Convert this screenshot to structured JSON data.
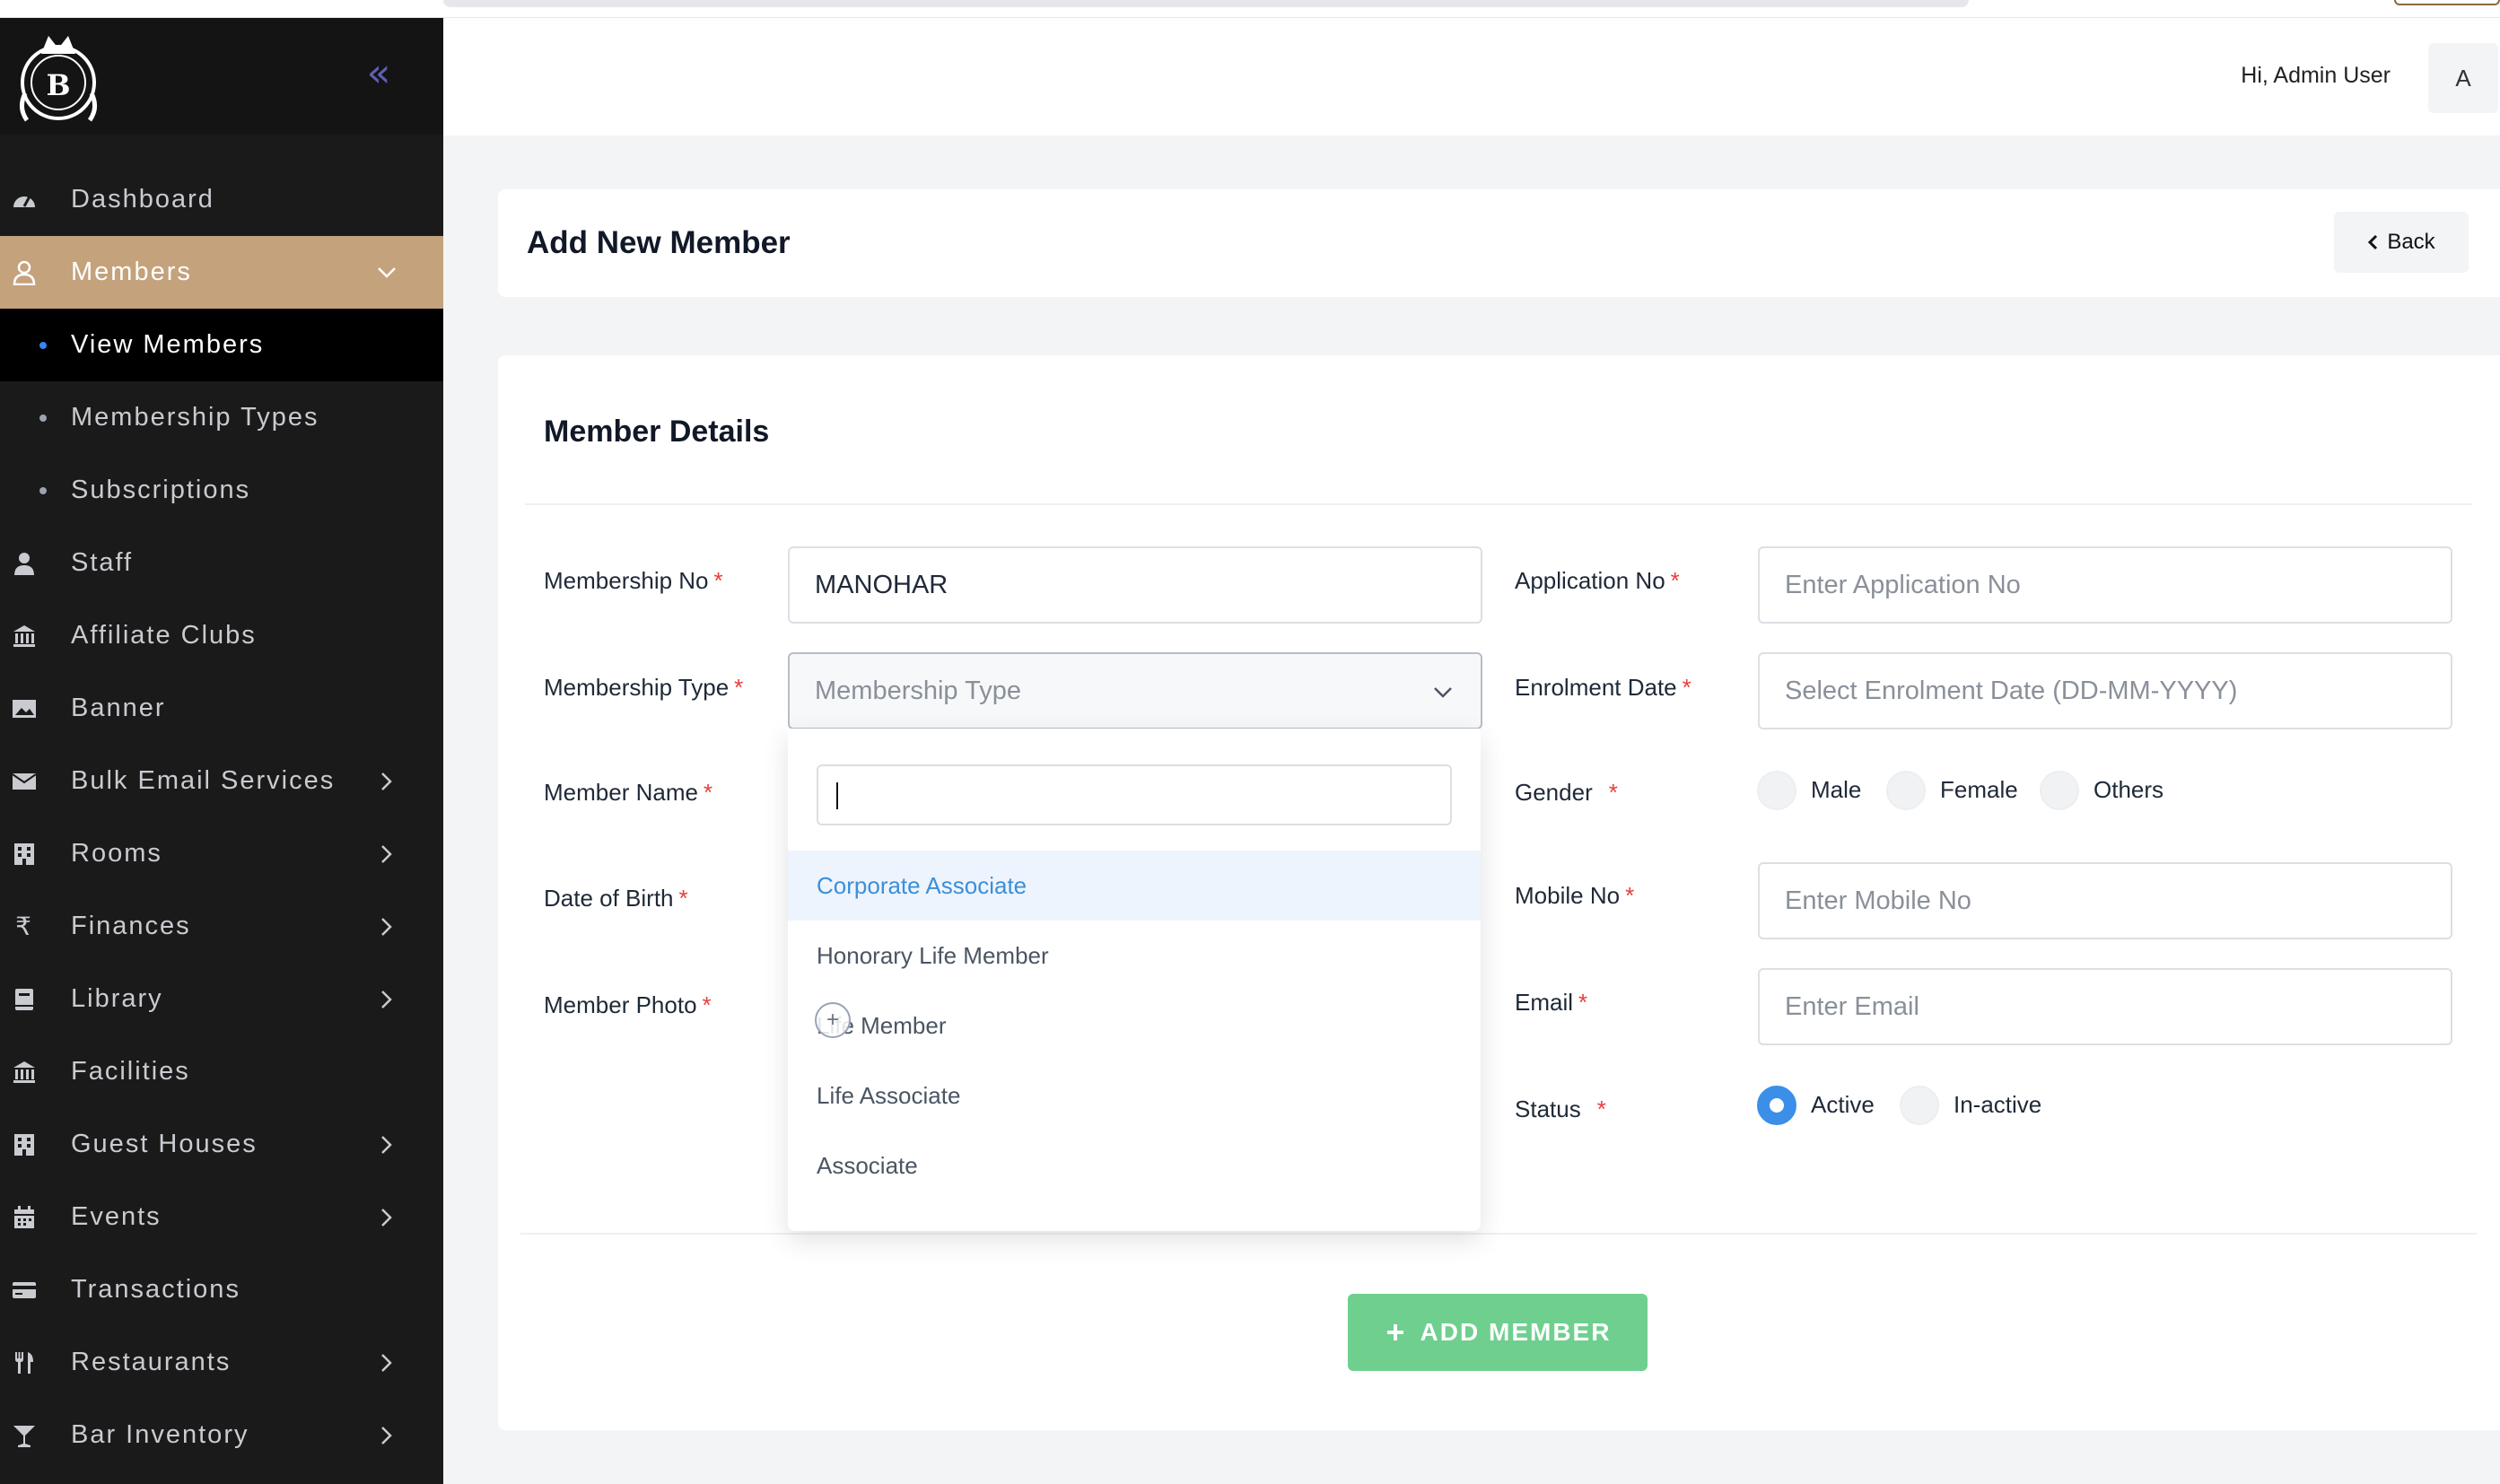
{
  "header": {
    "greeting": "Hi, Admin User",
    "avatar_initial": "A"
  },
  "sidebar": {
    "items": [
      {
        "label": "Dashboard",
        "icon": "dashboard-icon"
      },
      {
        "label": "Members",
        "icon": "user-icon",
        "expanded": true
      },
      {
        "label": "View Members",
        "sub": true,
        "active": true
      },
      {
        "label": "Membership Types",
        "sub": true
      },
      {
        "label": "Subscriptions",
        "sub": true
      },
      {
        "label": "Staff",
        "icon": "staff-icon"
      },
      {
        "label": "Affiliate Clubs",
        "icon": "bank-icon"
      },
      {
        "label": "Banner",
        "icon": "image-icon"
      },
      {
        "label": "Bulk Email Services",
        "icon": "envelope-icon",
        "has_children": true
      },
      {
        "label": "Rooms",
        "icon": "building-icon",
        "has_children": true
      },
      {
        "label": "Finances",
        "icon": "rupee-icon",
        "has_children": true
      },
      {
        "label": "Library",
        "icon": "book-icon",
        "has_children": true
      },
      {
        "label": "Facilities",
        "icon": "bank-icon"
      },
      {
        "label": "Guest Houses",
        "icon": "building-icon",
        "has_children": true
      },
      {
        "label": "Events",
        "icon": "calendar-icon",
        "has_children": true
      },
      {
        "label": "Transactions",
        "icon": "credit-card-icon"
      },
      {
        "label": "Restaurants",
        "icon": "utensils-icon",
        "has_children": true
      },
      {
        "label": "Bar Inventory",
        "icon": "cocktail-icon",
        "has_children": true
      }
    ]
  },
  "page": {
    "title": "Add New Member",
    "back_label": "Back"
  },
  "form": {
    "section_title": "Member Details",
    "membership_no": {
      "label": "Membership No",
      "value": "MANOHAR"
    },
    "application_no": {
      "label": "Application No",
      "placeholder": "Enter Application No"
    },
    "membership_type": {
      "label": "Membership Type",
      "placeholder": "Membership Type"
    },
    "enrolment_date": {
      "label": "Enrolment Date",
      "placeholder": "Select Enrolment Date (DD-MM-YYYY)"
    },
    "member_name": {
      "label": "Member Name"
    },
    "gender": {
      "label": "Gender",
      "options": [
        "Male",
        "Female",
        "Others"
      ]
    },
    "date_of_birth": {
      "label": "Date of Birth"
    },
    "mobile_no": {
      "label": "Mobile No",
      "placeholder": "Enter Mobile No"
    },
    "member_photo": {
      "label": "Member Photo"
    },
    "email": {
      "label": "Email",
      "placeholder": "Enter Email"
    },
    "status": {
      "label": "Status",
      "options": [
        "Active",
        "In-active"
      ],
      "selected": "Active"
    },
    "submit_label": "ADD MEMBER"
  },
  "dropdown": {
    "search_value": "",
    "options": [
      "Corporate Associate",
      "Honorary Life Member",
      "Life Member",
      "Life Associate",
      "Associate"
    ],
    "highlighted": "Corporate Associate"
  },
  "colors": {
    "sidebar_bg": "#1a1a1a",
    "active_accent": "#c4a27c",
    "link_blue": "#3b8fd9",
    "submit_green": "#6fcf8f",
    "required_red": "#e53e3e"
  }
}
